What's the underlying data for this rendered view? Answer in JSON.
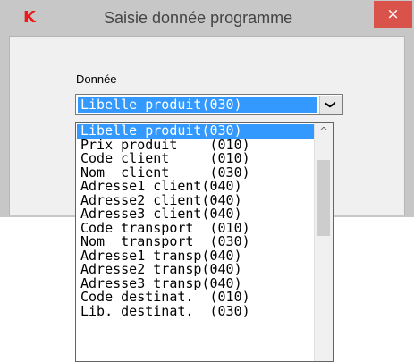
{
  "window": {
    "title": "Saisie donnée programme",
    "close_icon": "×",
    "app_icon": "K"
  },
  "form": {
    "label": "Donnée",
    "combo_value": "Libelle produit(030)",
    "combo_arrow": "❯"
  },
  "list": {
    "selected_index": 0,
    "items": [
      "Libelle produit(030)",
      "Prix produit    (010)",
      "Code client     (010)",
      "Nom  client     (030)",
      "Adresse1 client(040)",
      "Adresse2 client(040)",
      "Adresse3 client(040)",
      "Code transport  (010)",
      "Nom  transport  (030)",
      "Adresse1 transp(040)",
      "Adresse2 transp(040)",
      "Adresse3 transp(040)",
      "Code destinat.  (010)",
      "Lib. destinat.  (030)"
    ],
    "scroll_up": "^"
  },
  "colors": {
    "selection": "#3399ff",
    "close": "#d9534a",
    "app_icon": "#e81c1c"
  }
}
